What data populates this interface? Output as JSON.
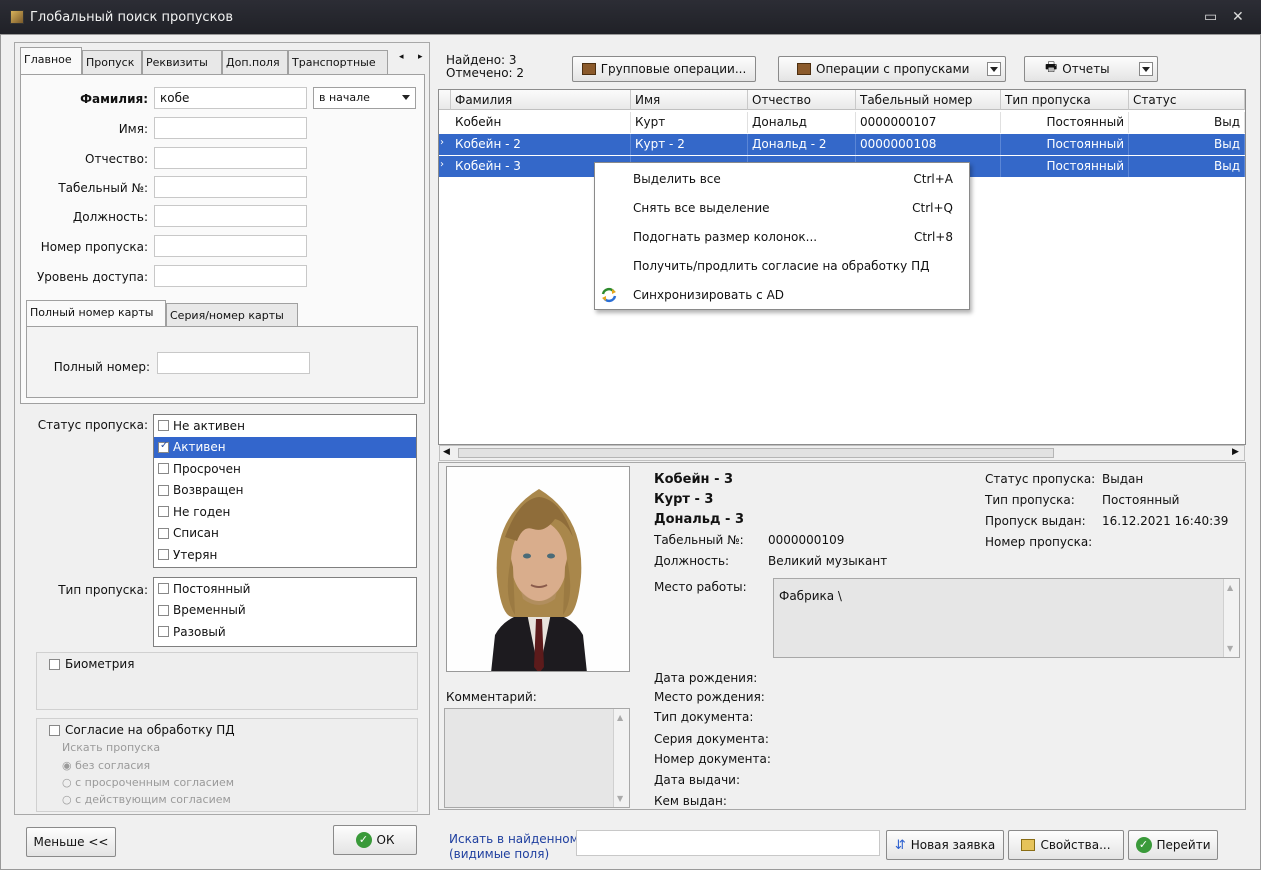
{
  "window": {
    "title": "Глобальный поиск пропусков"
  },
  "left": {
    "tabs": [
      "Главное",
      "Пропуск",
      "Реквизиты",
      "Доп.поля",
      "Транспортные"
    ],
    "fields": {
      "surname_label": "Фамилия:",
      "surname_value": "кобе",
      "match_mode": "в начале",
      "name_label": "Имя:",
      "patronymic_label": "Отчество:",
      "tabnum_label": "Табельный №:",
      "position_label": "Должность:",
      "pass_number_label": "Номер пропуска:",
      "access_level_label": "Уровень доступа:"
    },
    "card_tabs": [
      "Полный номер карты",
      "Серия/номер карты"
    ],
    "full_number_label": "Полный номер:",
    "status_label": "Статус пропуска:",
    "status_items": [
      {
        "label": "Не активен",
        "checked": false
      },
      {
        "label": "Активен",
        "checked": true
      },
      {
        "label": "Просрочен",
        "checked": false
      },
      {
        "label": "Возвращен",
        "checked": false
      },
      {
        "label": "Не годен",
        "checked": false
      },
      {
        "label": "Списан",
        "checked": false
      },
      {
        "label": "Утерян",
        "checked": false
      }
    ],
    "type_label": "Тип пропуска:",
    "type_items": [
      "Постоянный",
      "Временный",
      "Разовый"
    ],
    "biometry": "Биометрия",
    "consent": "Согласие на обработку ПД",
    "search_passes": "Искать пропуска",
    "consent_options": [
      "без согласия",
      "с просроченным согласием",
      "с действующим согласием"
    ],
    "less_button": "Меньше <<",
    "ok_button": "ОК"
  },
  "toolbar": {
    "found": "Найдено: 3",
    "marked": "Отмечено: 2",
    "group_ops": "Групповые операции...",
    "pass_ops": "Операции с пропусками",
    "reports": "Отчеты"
  },
  "grid": {
    "columns": [
      "Фамилия",
      "Имя",
      "Отчество",
      "Табельный номер",
      "Тип пропуска",
      "Статус"
    ],
    "rows": [
      [
        "Кобейн",
        "Курт",
        "Дональд",
        "0000000107",
        "Постоянный",
        "Выд"
      ],
      [
        "Кобейн - 2",
        "Курт - 2",
        "Дональд - 2",
        "0000000108",
        "Постоянный",
        "Выд"
      ],
      [
        "Кобейн - 3",
        "",
        "",
        "",
        "Постоянный",
        "Выд"
      ]
    ]
  },
  "context_menu": [
    {
      "label": "Выделить все",
      "shortcut": "Ctrl+A"
    },
    {
      "label": "Снять все выделение",
      "shortcut": "Ctrl+Q"
    },
    {
      "label": "Подогнать размер колонок...",
      "shortcut": "Ctrl+8"
    },
    {
      "label": "Получить/продлить согласие на обработку ПД",
      "shortcut": ""
    },
    {
      "label": "Синхронизировать с AD",
      "shortcut": "",
      "icon": "sync-icon"
    }
  ],
  "details": {
    "surname": "Кобейн - 3",
    "name": "Курт - 3",
    "patronymic": "Дональд - 3",
    "tabnum_label": "Табельный №:",
    "tabnum": "0000000109",
    "position_label": "Должность:",
    "position": "Великий музыкант",
    "workplace_label": "Место работы:",
    "workplace": "Фабрика \\",
    "status_label": "Статус пропуска:",
    "status": "Выдан",
    "type_label": "Тип пропуска:",
    "type": "Постоянный",
    "issued_label": "Пропуск выдан:",
    "issued": "16.12.2021 16:40:39",
    "number_label": "Номер пропуска:",
    "comment_label": "Комментарий:",
    "birth_date": "Дата рождения:",
    "birth_place": "Место рождения:",
    "doc_type": "Тип документа:",
    "doc_series": "Серия документа:",
    "doc_number": "Номер документа:",
    "issue_date": "Дата выдачи:",
    "issued_by": "Кем выдан:"
  },
  "bottom": {
    "search_label_1": "Искать в найденном",
    "search_label_2": "(видимые поля)",
    "new_request": "Новая заявка",
    "properties": "Свойства...",
    "go": "Перейти"
  },
  "colors": {
    "selection": "#3468c9",
    "ok_icon": "#3a9a3a"
  }
}
